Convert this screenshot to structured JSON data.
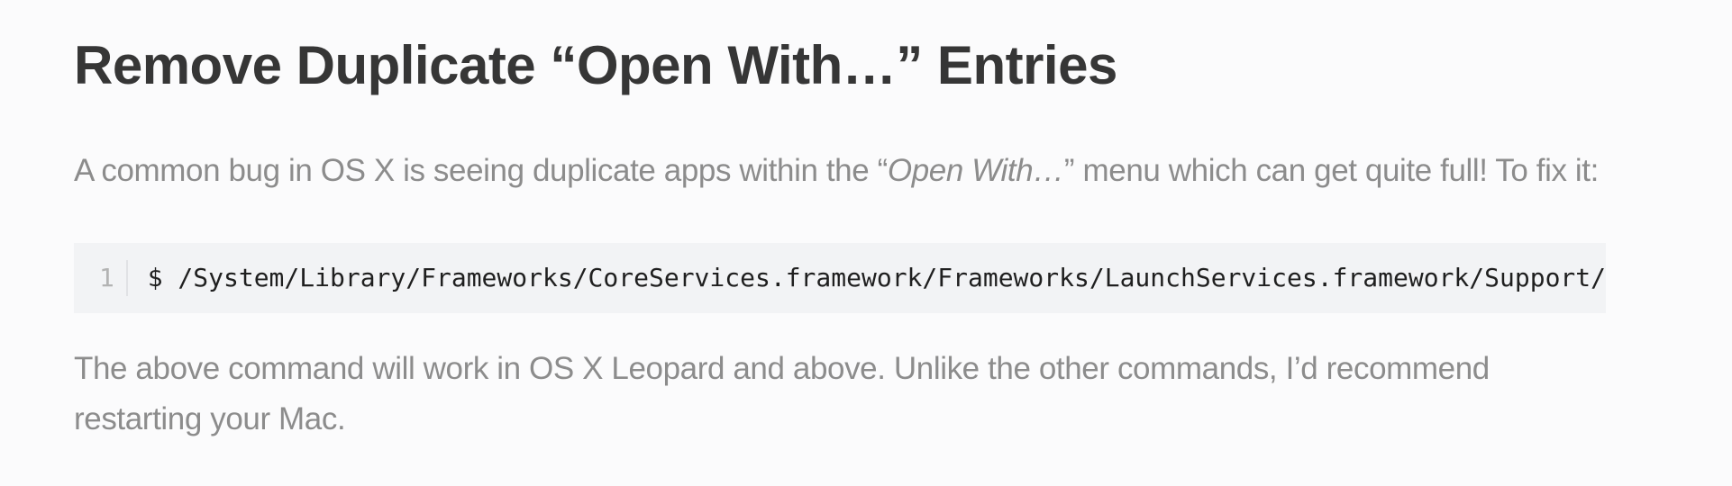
{
  "article": {
    "heading": "Remove Duplicate “Open With…” Entries",
    "intro": {
      "before": "A common bug in OS X is seeing duplicate apps within the “",
      "emphasis": "Open With…",
      "after": "” menu which can get quite full! To fix it:"
    },
    "code": {
      "line_number": "1",
      "command": "$ /System/Library/Frameworks/CoreServices.framework/Frameworks/LaunchServices.framework/Support/"
    },
    "outro": {
      "line1": "The above command will work in OS X Leopard and above. Unlike the other commands, I’d recommend",
      "line2": "restarting your Mac."
    }
  },
  "colors": {
    "heading": "#363636",
    "body_text": "#8c8c8c",
    "code_background": "#f2f3f5",
    "line_number": "#b3b3b3"
  }
}
